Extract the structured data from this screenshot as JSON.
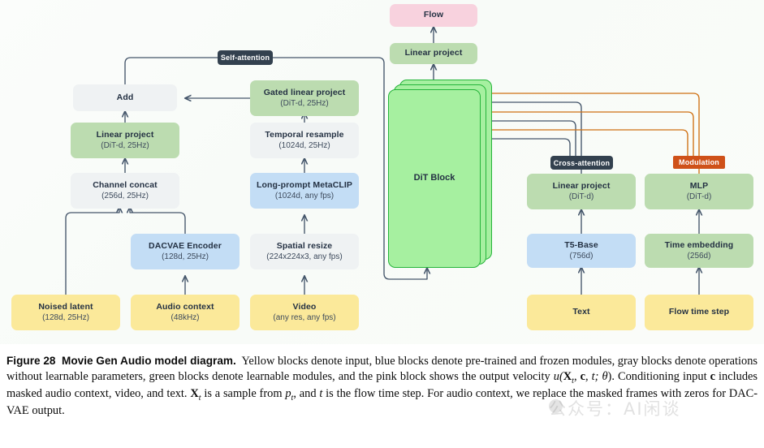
{
  "figure": {
    "background_color": "#fafcf9",
    "caption_label": "Figure 28",
    "caption_title": "Movie Gen Audio model diagram.",
    "caption_seg_1": "Yellow blocks denote input, blue blocks denote pre-trained and frozen modules, gray blocks denote operations without learnable parameters, green blocks denote learnable modules, and the pink block shows the output velocity ",
    "caption_formula_u": "u(",
    "caption_formula_X": "X",
    "caption_formula_Xsub": "t",
    "caption_formula_mid": ", ",
    "caption_formula_c": "c",
    "caption_formula_t": ", t; θ",
    "caption_formula_end": ").",
    "caption_seg_2": " Conditioning input ",
    "caption_c2": "c",
    "caption_seg_3": " includes masked audio context, video, and text. ",
    "caption_X2": "X",
    "caption_X2sub": "t",
    "caption_seg_4": " is a sample from ",
    "caption_p": "p",
    "caption_psub": "t",
    "caption_seg_5": ", and ",
    "caption_t2": "t",
    "caption_seg_6": " is the flow time step. For audio context, we replace the masked frames with zeros for DAC-VAE output.",
    "watermark_text": "公众号：AI闲谈"
  },
  "colors": {
    "input_yellow": "#fbe99a",
    "frozen_blue": "#c3ddf5",
    "learnable_green": "#bcdcb0",
    "operation_gray": "#eff2f3",
    "output_pink": "#f8d2de",
    "dit_green_fill": "#a6f0a0",
    "dit_green_stroke": "#25b43a",
    "wire_dark": "#44556a",
    "wire_orange": "#cf7012",
    "badge_dark": "#33414f",
    "badge_orange": "#cf5119"
  },
  "nodes": {
    "noised_latent": {
      "title": "Noised latent",
      "sub": "(128d, 25Hz)",
      "kind": "input"
    },
    "audio_context": {
      "title": "Audio context",
      "sub": "(48kHz)",
      "kind": "input"
    },
    "video": {
      "title": "Video",
      "sub": "(any res, any fps)",
      "kind": "input"
    },
    "text": {
      "title": "Text",
      "sub": "",
      "kind": "input"
    },
    "flow_time_step": {
      "title": "Flow time step",
      "sub": "",
      "kind": "input"
    },
    "dacvae_encoder": {
      "title": "DACVAE Encoder",
      "sub": "(128d, 25Hz)",
      "kind": "frozen"
    },
    "spatial_resize": {
      "title": "Spatial resize",
      "sub": "(224x224x3, any fps)",
      "kind": "operation"
    },
    "metaclip": {
      "title": "Long-prompt MetaCLIP",
      "sub": "(1024d, any fps)",
      "kind": "frozen"
    },
    "t5_base": {
      "title": "T5-Base",
      "sub": "(756d)",
      "kind": "frozen"
    },
    "time_embedding": {
      "title": "Time embedding",
      "sub": "(256d)",
      "kind": "learnable"
    },
    "channel_concat": {
      "title": "Channel concat",
      "sub": "(256d, 25Hz)",
      "kind": "operation"
    },
    "temporal_resample": {
      "title": "Temporal resample",
      "sub": "(1024d, 25Hz)",
      "kind": "operation"
    },
    "linear_project_l": {
      "title": "Linear project",
      "sub": "(DiT-d, 25Hz)",
      "kind": "learnable"
    },
    "gated_linear_project": {
      "title": "Gated linear project",
      "sub": "(DiT-d, 25Hz)",
      "kind": "learnable"
    },
    "linear_project_ca": {
      "title": "Linear project",
      "sub": "(DiT-d)",
      "kind": "learnable"
    },
    "mlp": {
      "title": "MLP",
      "sub": "(DiT-d)",
      "kind": "learnable"
    },
    "add": {
      "title": "Add",
      "sub": "",
      "kind": "operation"
    },
    "dit_block": {
      "title": "DiT Block",
      "sub": "",
      "kind": "dit",
      "stack_count": 3
    },
    "linear_project_out": {
      "title": "Linear project",
      "sub": "",
      "kind": "learnable"
    },
    "flow": {
      "title": "Flow",
      "sub": "",
      "kind": "output"
    }
  },
  "badges": {
    "self_attention": "Self-attention",
    "cross_attention": "Cross-attention",
    "modulation": "Modulation"
  }
}
